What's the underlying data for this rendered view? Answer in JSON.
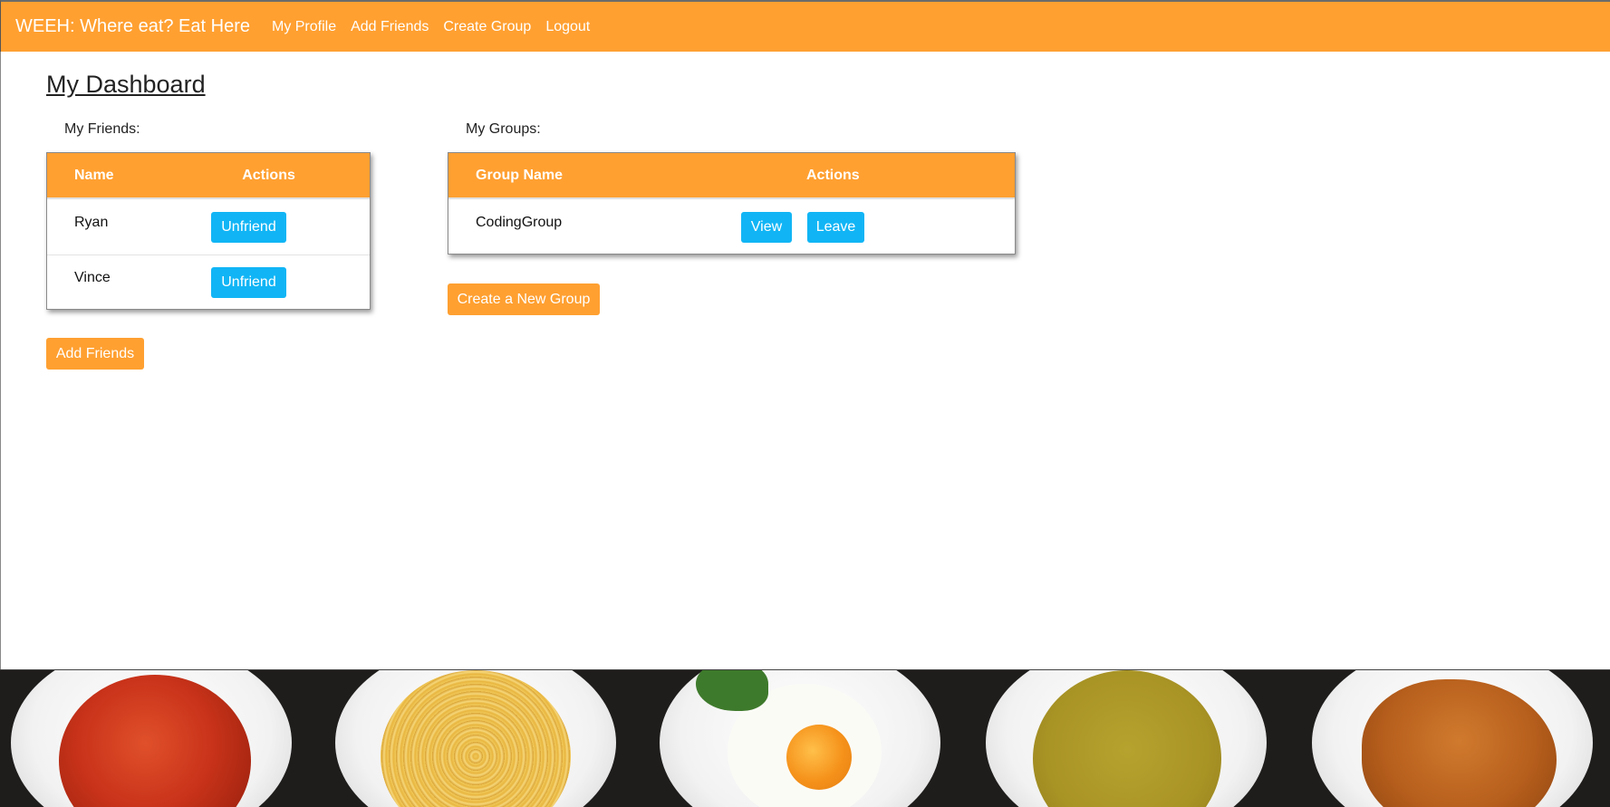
{
  "nav": {
    "brand": "WEEH: Where eat? Eat Here",
    "links": [
      "My Profile",
      "Add Friends",
      "Create Group",
      "Logout"
    ]
  },
  "page_title": "My Dashboard",
  "friends": {
    "label": "My Friends:",
    "headers": [
      "Name",
      "Actions"
    ],
    "rows": [
      {
        "name": "Ryan",
        "action": "Unfriend"
      },
      {
        "name": "Vince",
        "action": "Unfriend"
      }
    ],
    "add_button": "Add Friends"
  },
  "groups": {
    "label": "My Groups:",
    "headers": [
      "Group Name",
      "Actions"
    ],
    "rows": [
      {
        "name": "CodingGroup",
        "view": "View",
        "leave": "Leave"
      }
    ],
    "create_button": "Create a New Group"
  },
  "footer": {
    "dishes": [
      "minestrone-soup",
      "spaghetti",
      "fried-egg",
      "pea-soup",
      "croissants"
    ]
  },
  "colors": {
    "accent_orange": "#ffa031",
    "button_blue": "#11b5f5"
  }
}
